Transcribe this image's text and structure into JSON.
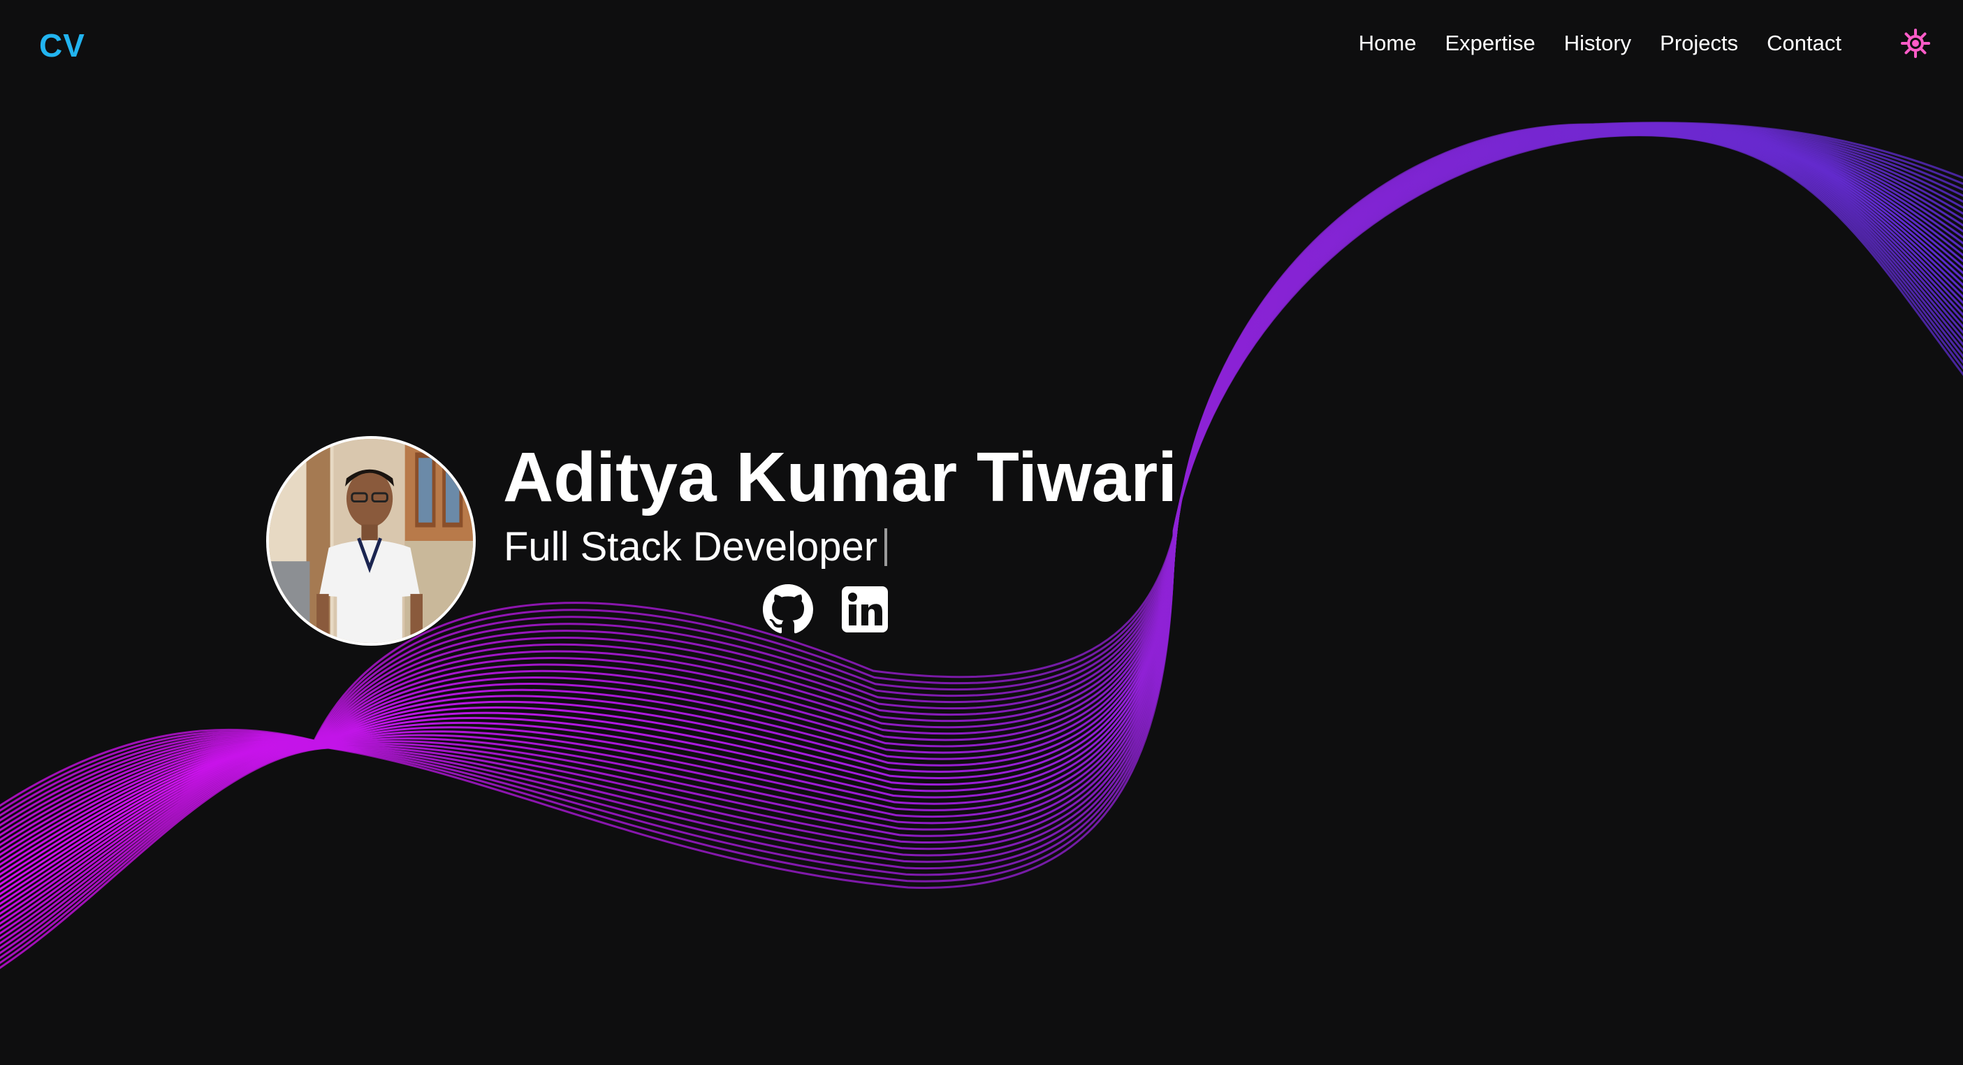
{
  "nav": {
    "logo": "CV",
    "links": [
      "Home",
      "Expertise",
      "History",
      "Projects",
      "Contact"
    ],
    "theme_toggle_icon": "sun-icon"
  },
  "hero": {
    "name": "Aditya Kumar Tiwari",
    "role": "Full Stack Developer",
    "avatar_icon": "profile-photo",
    "socials": [
      {
        "icon": "github-icon"
      },
      {
        "icon": "linkedin-icon"
      }
    ]
  },
  "colors": {
    "background": "#0e0e0f",
    "logo": "#22b4f0",
    "text": "#ffffff",
    "toggle": "#ff5cc8",
    "wave_start": "#d60ff0",
    "wave_end": "#5a2ccc"
  }
}
